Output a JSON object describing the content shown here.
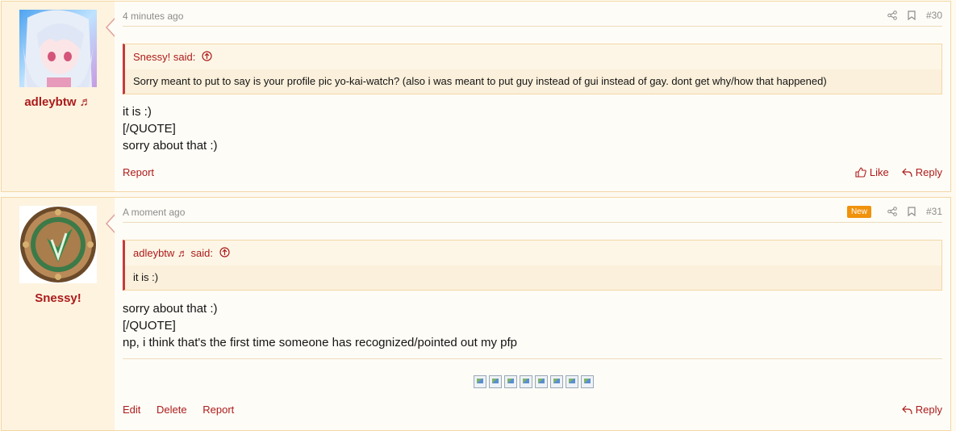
{
  "posts": [
    {
      "username": "adleybtw ♬",
      "time": "4 minutes ago",
      "number": "#30",
      "quote": {
        "author": "Snessy! said:",
        "text": "Sorry meant to put to say is your profile pic yo-kai-watch? (also i was meant to put guy instead of gui instead of gay. dont get why/how that happened)"
      },
      "body": [
        "it is :)",
        "[/QUOTE]",
        "sorry about that :)"
      ],
      "footer": {
        "report": "Report",
        "like": "Like",
        "reply": "Reply"
      }
    },
    {
      "username": "Snessy!",
      "time": "A moment ago",
      "badge": "New",
      "number": "#31",
      "quote": {
        "author": "adleybtw ♬ said:",
        "text": "it is :)"
      },
      "body": [
        "sorry about that :)",
        "[/QUOTE]",
        "np, i think that's the first time someone has recognized/pointed out my pfp"
      ],
      "signature_image_count": 8,
      "footer": {
        "edit": "Edit",
        "delete": "Delete",
        "report": "Report",
        "reply": "Reply"
      }
    }
  ],
  "colors": {
    "accent": "#ac1b1b",
    "border": "#f3d7a6",
    "badge": "#f0920c"
  },
  "icons": [
    "share-icon",
    "bookmark-icon",
    "arrow-up-circle-icon",
    "thumbs-up-icon",
    "reply-icon",
    "broken-image-icon"
  ]
}
